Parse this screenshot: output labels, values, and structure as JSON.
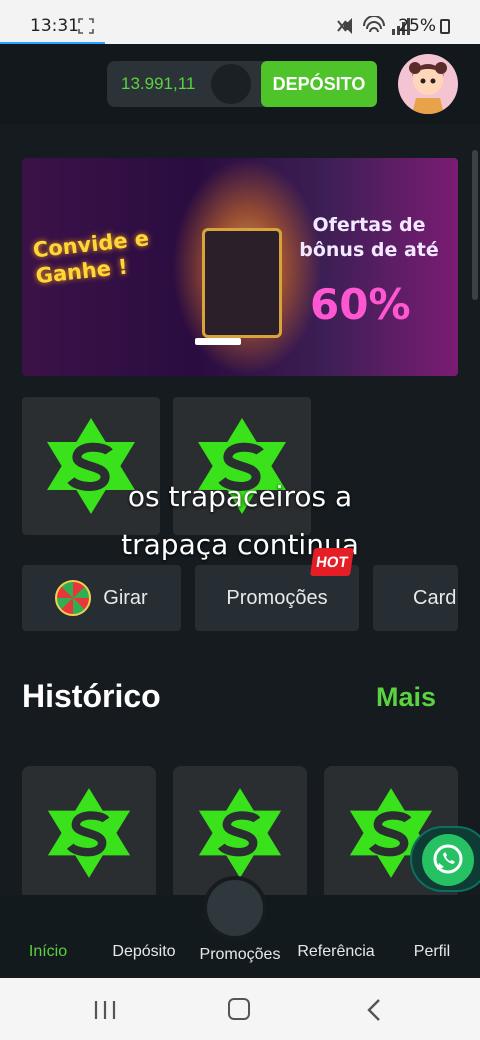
{
  "status_bar": {
    "time": "13:31",
    "battery": "25%"
  },
  "header": {
    "balance": "13.991,11",
    "deposit_label": "DEPÓSITO"
  },
  "banner": {
    "left_text": "Convide e Ganhe !",
    "right_text": "Ofertas de bônus de até",
    "percent": "60%"
  },
  "overlay": {
    "line1": "os trapaceiros a",
    "line2": "trapaça continua"
  },
  "quick_actions": [
    {
      "label": "Girar"
    },
    {
      "label": "Promoções",
      "badge": "HOT"
    },
    {
      "label": "Card"
    }
  ],
  "history": {
    "title": "Histórico",
    "more_label": "Mais"
  },
  "bottom_nav": [
    {
      "label": "Início",
      "active": true
    },
    {
      "label": "Depósito"
    },
    {
      "label": "Promoções"
    },
    {
      "label": "Referência"
    },
    {
      "label": "Perfil"
    }
  ],
  "colors": {
    "accent_green": "#5bd23f",
    "deposit_green": "#4fc42a",
    "background": "#151b1f",
    "hot_red": "#e51e25",
    "whatsapp_green": "#25c163"
  }
}
